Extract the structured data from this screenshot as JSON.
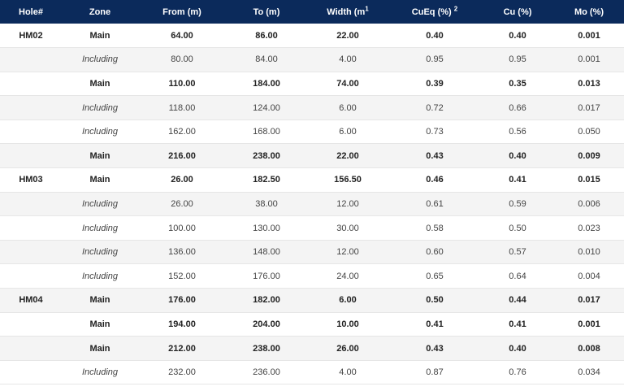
{
  "header": {
    "hole": "Hole#",
    "zone": "Zone",
    "from": "From (m)",
    "to": "To (m)",
    "width": "Width (m",
    "width_sup": "1",
    "cueq": "CuEq (%) ",
    "cueq_sup": "2",
    "cu": "Cu (%)",
    "mo": "Mo (%)"
  },
  "rows": [
    {
      "hole": "HM02",
      "zone": "Main",
      "type": "main",
      "from": "64.00",
      "to": "86.00",
      "width": "22.00",
      "cueq": "0.40",
      "cu": "0.40",
      "mo": "0.001"
    },
    {
      "hole": "",
      "zone": "Including",
      "type": "incl",
      "from": "80.00",
      "to": "84.00",
      "width": "4.00",
      "cueq": "0.95",
      "cu": "0.95",
      "mo": "0.001"
    },
    {
      "hole": "",
      "zone": "Main",
      "type": "main",
      "from": "110.00",
      "to": "184.00",
      "width": "74.00",
      "cueq": "0.39",
      "cu": "0.35",
      "mo": "0.013"
    },
    {
      "hole": "",
      "zone": "Including",
      "type": "incl",
      "from": "118.00",
      "to": "124.00",
      "width": "6.00",
      "cueq": "0.72",
      "cu": "0.66",
      "mo": "0.017"
    },
    {
      "hole": "",
      "zone": "Including",
      "type": "incl",
      "from": "162.00",
      "to": "168.00",
      "width": "6.00",
      "cueq": "0.73",
      "cu": "0.56",
      "mo": "0.050"
    },
    {
      "hole": "",
      "zone": "Main",
      "type": "main",
      "from": "216.00",
      "to": "238.00",
      "width": "22.00",
      "cueq": "0.43",
      "cu": "0.40",
      "mo": "0.009"
    },
    {
      "hole": "HM03",
      "zone": "Main",
      "type": "main",
      "from": "26.00",
      "to": "182.50",
      "width": "156.50",
      "cueq": "0.46",
      "cu": "0.41",
      "mo": "0.015"
    },
    {
      "hole": "",
      "zone": "Including",
      "type": "incl",
      "from": "26.00",
      "to": "38.00",
      "width": "12.00",
      "cueq": "0.61",
      "cu": "0.59",
      "mo": "0.006"
    },
    {
      "hole": "",
      "zone": "Including",
      "type": "incl",
      "from": "100.00",
      "to": "130.00",
      "width": "30.00",
      "cueq": "0.58",
      "cu": "0.50",
      "mo": "0.023"
    },
    {
      "hole": "",
      "zone": "Including",
      "type": "incl",
      "from": "136.00",
      "to": "148.00",
      "width": "12.00",
      "cueq": "0.60",
      "cu": "0.57",
      "mo": "0.010"
    },
    {
      "hole": "",
      "zone": "Including",
      "type": "incl",
      "from": "152.00",
      "to": "176.00",
      "width": "24.00",
      "cueq": "0.65",
      "cu": "0.64",
      "mo": "0.004"
    },
    {
      "hole": "HM04",
      "zone": "Main",
      "type": "main",
      "from": "176.00",
      "to": "182.00",
      "width": "6.00",
      "cueq": "0.50",
      "cu": "0.44",
      "mo": "0.017"
    },
    {
      "hole": "",
      "zone": "Main",
      "type": "main",
      "from": "194.00",
      "to": "204.00",
      "width": "10.00",
      "cueq": "0.41",
      "cu": "0.41",
      "mo": "0.001"
    },
    {
      "hole": "",
      "zone": "Main",
      "type": "main",
      "from": "212.00",
      "to": "238.00",
      "width": "26.00",
      "cueq": "0.43",
      "cu": "0.40",
      "mo": "0.008"
    },
    {
      "hole": "",
      "zone": "Including",
      "type": "incl",
      "from": "232.00",
      "to": "236.00",
      "width": "4.00",
      "cueq": "0.87",
      "cu": "0.76",
      "mo": "0.034"
    }
  ],
  "colors": {
    "header_bg": "#0b2a5b",
    "header_text": "#ffffff",
    "alt_row_bg": "#f4f4f4"
  }
}
